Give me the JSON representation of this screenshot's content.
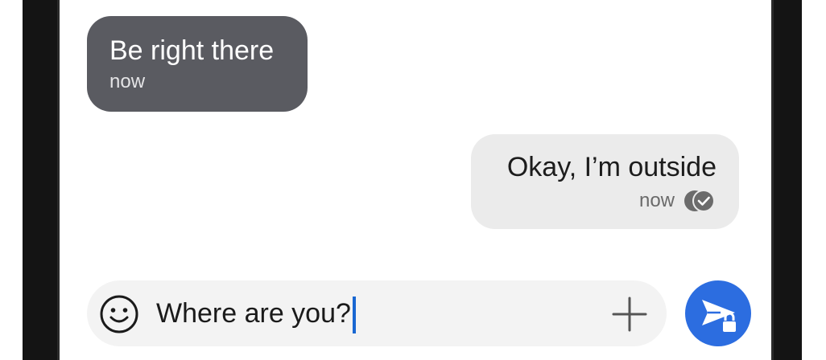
{
  "conversation": {
    "incoming": {
      "text": "Be right there",
      "time": "now"
    },
    "outgoing": {
      "text": "Okay, I’m outside",
      "time": "now",
      "status_icon": "read-receipt-icon"
    }
  },
  "composer": {
    "value": "Where are you?",
    "emoji_icon": "emoji-icon",
    "attach_icon": "plus-icon",
    "send_icon": "send-secure-icon"
  },
  "colors": {
    "incoming_bubble": "#5a5b61",
    "outgoing_bubble": "#ebebeb",
    "send_button": "#2c6de0",
    "caret": "#1967d2"
  }
}
